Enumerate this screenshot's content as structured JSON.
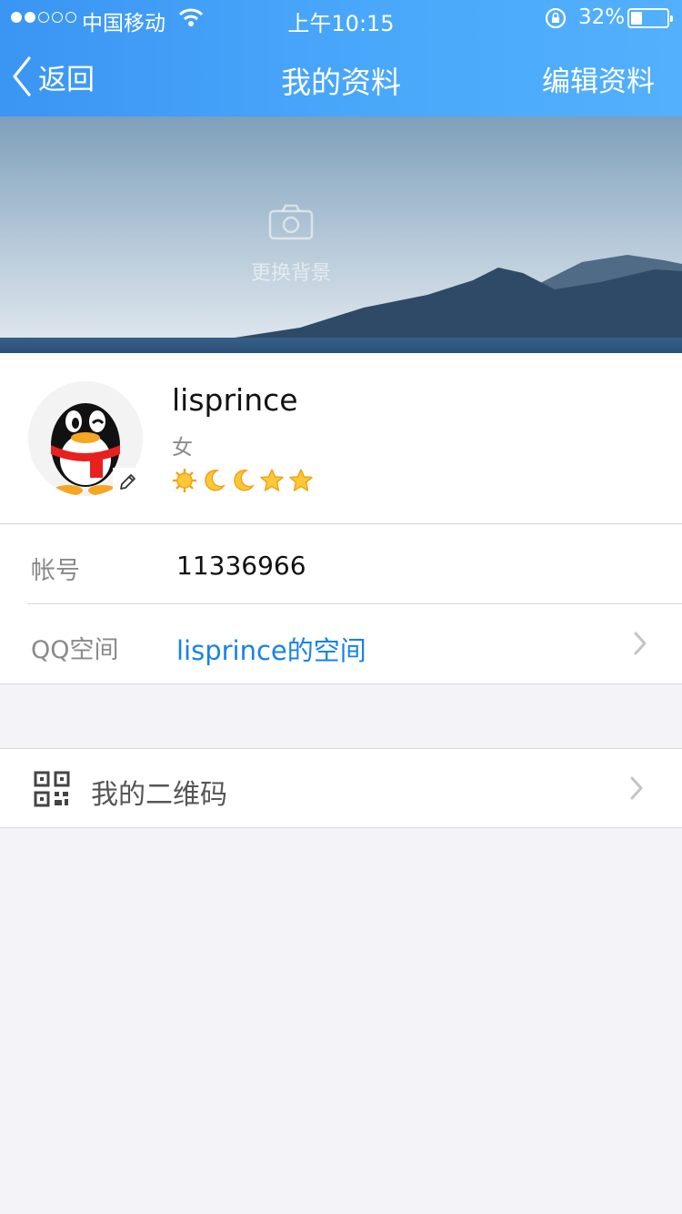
{
  "status_bar": {
    "carrier": "中国移动",
    "time": "上午10:15",
    "battery_percent": "32%",
    "battery_level": 0.32,
    "signal_bars_filled": 2,
    "signal_bars_total": 5,
    "icons": [
      "wifi-icon",
      "orientation-lock-icon",
      "battery-icon"
    ]
  },
  "nav": {
    "back_label": "返回",
    "title": "我的资料",
    "edit_label": "编辑资料"
  },
  "cover": {
    "change_label": "更换背景",
    "icon": "camera-icon"
  },
  "profile": {
    "nickname": "lisprince",
    "gender": "女",
    "level_icons": [
      "sun",
      "moon",
      "moon",
      "star",
      "star"
    ]
  },
  "info": {
    "rows": [
      {
        "label": "帐号",
        "value": "11336966"
      },
      {
        "label": "QQ空间",
        "value": "lisprince的空间"
      }
    ]
  },
  "qr_row": {
    "label": "我的二维码",
    "icon": "qr-code-icon"
  },
  "colors": {
    "nav_blue": "#3a95f3",
    "link_blue": "#1782e8",
    "page_bg": "#f4f4f8",
    "level_gold": "#f6b31d"
  }
}
